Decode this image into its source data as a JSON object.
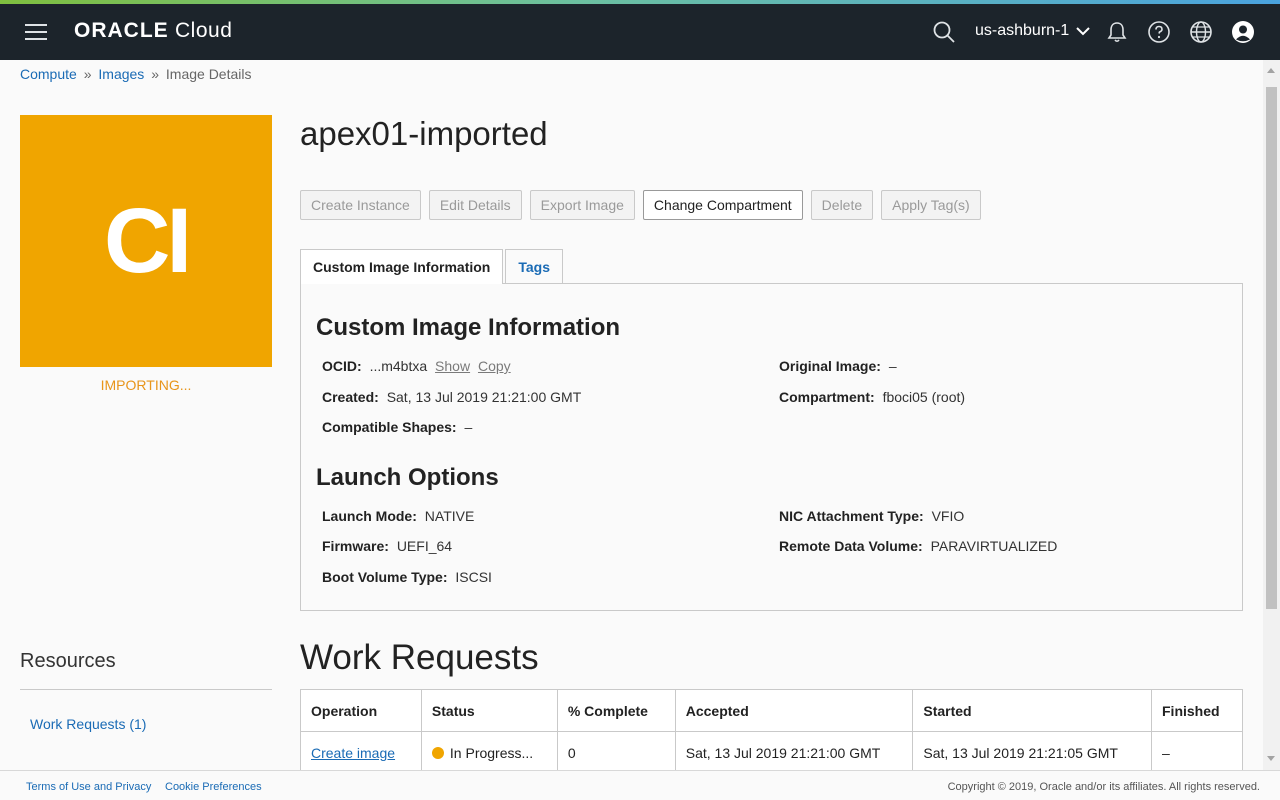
{
  "header": {
    "brand_bold": "ORACLE",
    "brand_light": "Cloud",
    "region": "us-ashburn-1"
  },
  "breadcrumb": {
    "compute": "Compute",
    "images": "Images",
    "current": "Image Details",
    "separator": "»"
  },
  "image": {
    "badge_text": "CI",
    "badge_color": "#f0a500",
    "status": "IMPORTING...",
    "title": "apex01-imported"
  },
  "actions": {
    "create_instance": "Create Instance",
    "edit_details": "Edit Details",
    "export_image": "Export Image",
    "change_compartment": "Change Compartment",
    "delete": "Delete",
    "apply_tags": "Apply Tag(s)"
  },
  "tabs": {
    "info": "Custom Image Information",
    "tags": "Tags"
  },
  "info": {
    "heading": "Custom Image Information",
    "ocid_label": "OCID:",
    "ocid_value": "...m4btxa",
    "show": "Show",
    "copy": "Copy",
    "original_image_label": "Original Image:",
    "original_image_value": "–",
    "created_label": "Created:",
    "created_value": "Sat, 13 Jul 2019 21:21:00 GMT",
    "compartment_label": "Compartment:",
    "compartment_value": "fboci05 (root)",
    "shapes_label": "Compatible Shapes:",
    "shapes_value": "–"
  },
  "launch": {
    "heading": "Launch Options",
    "mode_label": "Launch Mode:",
    "mode_value": "NATIVE",
    "nic_label": "NIC Attachment Type:",
    "nic_value": "VFIO",
    "firmware_label": "Firmware:",
    "firmware_value": "UEFI_64",
    "remote_label": "Remote Data Volume:",
    "remote_value": "PARAVIRTUALIZED",
    "boot_label": "Boot Volume Type:",
    "boot_value": "ISCSI"
  },
  "resources": {
    "heading": "Resources",
    "work_requests_link": "Work Requests (1)"
  },
  "work_requests": {
    "heading": "Work Requests",
    "columns": [
      "Operation",
      "Status",
      "% Complete",
      "Accepted",
      "Started",
      "Finished"
    ],
    "rows": [
      {
        "operation": "Create image",
        "status": "In Progress...",
        "complete": "0",
        "accepted": "Sat, 13 Jul 2019 21:21:00 GMT",
        "started": "Sat, 13 Jul 2019 21:21:05 GMT",
        "finished": "–"
      }
    ]
  },
  "footer": {
    "terms": "Terms of Use and Privacy",
    "cookies": "Cookie Preferences",
    "copyright": "Copyright © 2019, Oracle and/or its affiliates. All rights reserved."
  }
}
